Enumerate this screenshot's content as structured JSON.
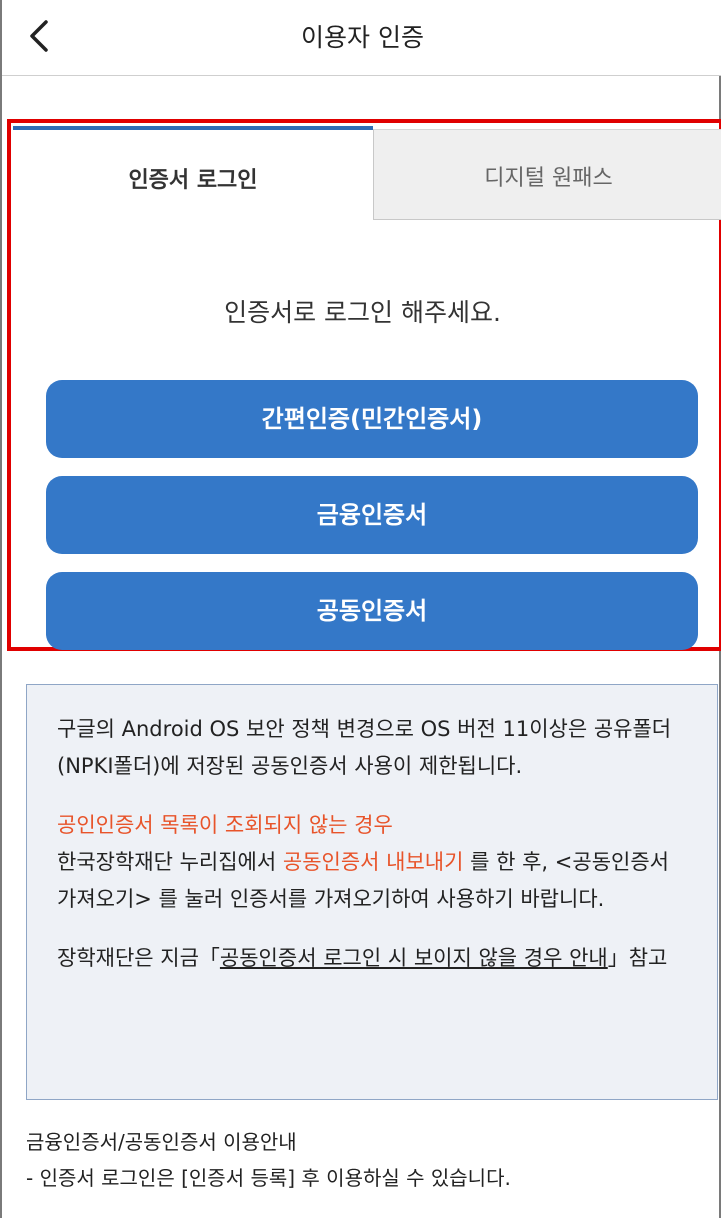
{
  "header": {
    "title": "이용자 인증",
    "back_icon": "chevron-left-icon"
  },
  "tabs": [
    {
      "label": "인증서 로그인",
      "active": true
    },
    {
      "label": "디지털 원패스",
      "active": false
    }
  ],
  "prompt": "인증서로 로그인 해주세요.",
  "buttons": [
    {
      "label": "간편인증(민간인증서)"
    },
    {
      "label": "금융인증서"
    },
    {
      "label": "공동인증서"
    }
  ],
  "notice": {
    "line1": "구글의 Android OS 보안 정책 변경으로 OS 버전 11이상은 공유폴더(NPKI폴더)에 저장된 공동인증서 사용이 제한됩니다.",
    "warning_title": "공인인증서 목록이 조회되지 않는 경우",
    "line2_prefix": "한국장학재단 누리집에서 ",
    "line2_link": "공동인증서 내보내기",
    "line2_suffix": " 를 한 후, <공동인증서 가져오기> 를 눌러 인증서를 가져오기하여 사용하기 바랍니다.",
    "line3_prefix": "장학재단은 지금「",
    "line3_link": "공동인증서 로그인 시 보이지 않을 경우 안내",
    "line3_suffix": "」참고"
  },
  "footer": {
    "title": "금융인증서/공동인증서 이용안내",
    "line": "- 인증서 로그인은 [인증서 등록] 후 이용하실 수 있습니다."
  },
  "colors": {
    "accent": "#3478c8",
    "highlight": "#e00000",
    "warning": "#e8542a",
    "notice_bg": "#eef1f6"
  }
}
